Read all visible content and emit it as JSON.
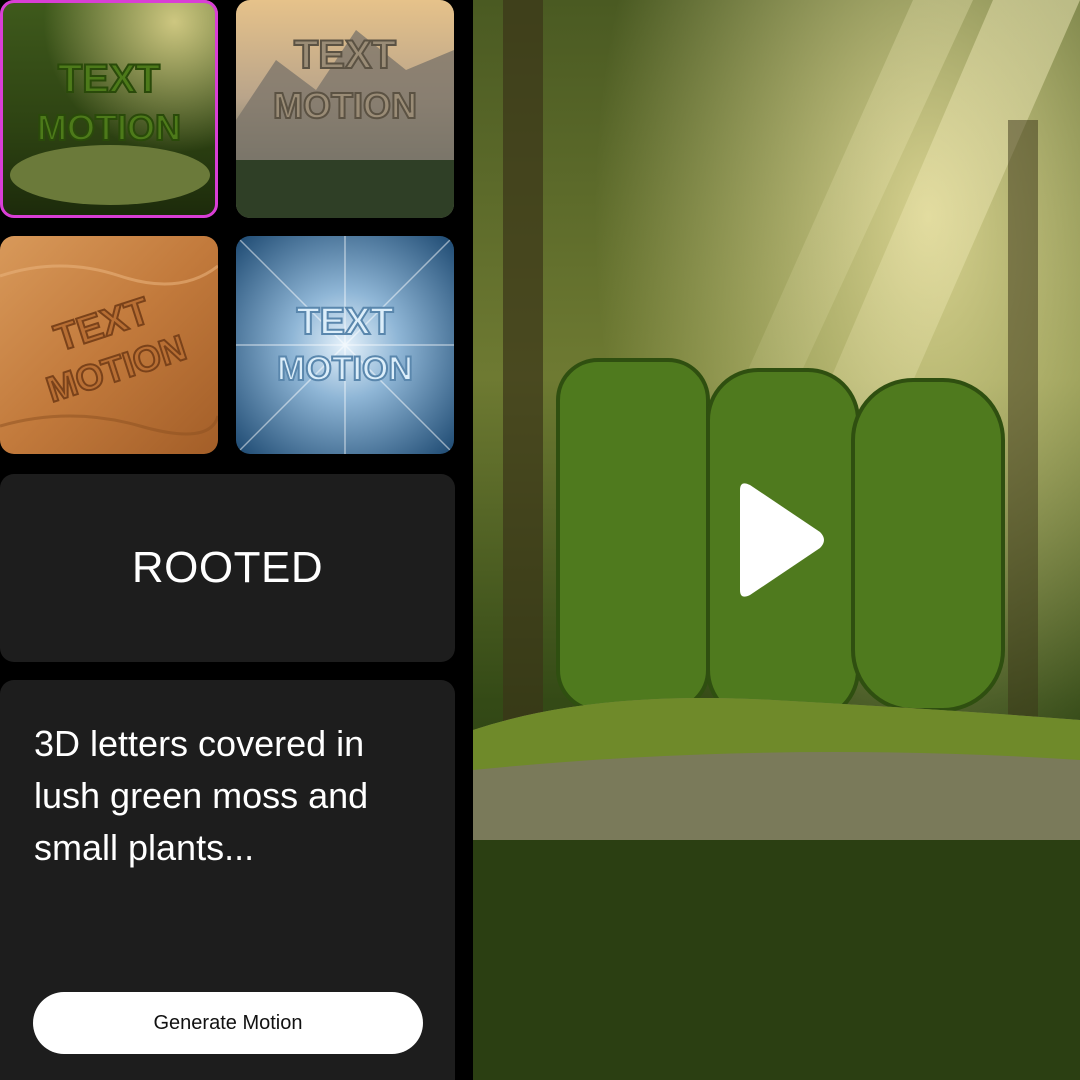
{
  "gallery": {
    "thumbnails": [
      {
        "line1": "TEXT",
        "line2": "MOTION",
        "style": "moss",
        "selected": true
      },
      {
        "line1": "TEXT",
        "line2": "MOTION",
        "style": "mountain",
        "selected": false
      },
      {
        "line1": "TEXT",
        "line2": "MOTION",
        "style": "sand",
        "selected": false
      },
      {
        "line1": "TEXT",
        "line2": "MOTION",
        "style": "ice",
        "selected": false
      }
    ]
  },
  "title_panel": {
    "word": "ROOTED"
  },
  "prompt_panel": {
    "prompt_text": "3D letters covered in lush green moss and small plants...",
    "generate_label": "Generate Motion"
  },
  "preview": {
    "icon": "play-icon"
  },
  "colors": {
    "accent": "#d93ed6",
    "panel": "#1d1d1d",
    "background": "#000000"
  }
}
